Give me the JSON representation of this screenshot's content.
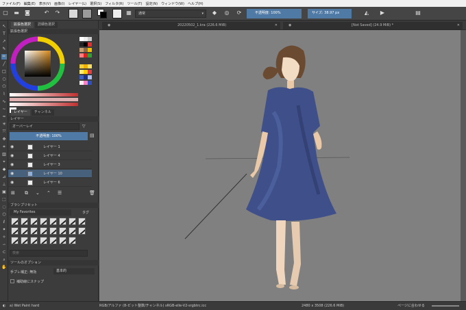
{
  "menu": [
    "ファイル(F)",
    "編集(E)",
    "表示(V)",
    "画像(I)",
    "レイヤー(L)",
    "選択(S)",
    "フィルタ(R)",
    "ツール(T)",
    "設定(N)",
    "ウィンドウ(W)",
    "ヘルプ(H)"
  ],
  "toolbar": {
    "blend_mode": "通常",
    "opacity_label": "不透明度:",
    "opacity_value": "100%",
    "size_label": "サイズ:",
    "size_value": "38.97 px"
  },
  "docker_tabs": [
    "拡張色選択",
    "詳細色選択"
  ],
  "color_panel_title": "拡張色選択",
  "layers": {
    "tabs": [
      "レイヤー",
      "チャンネル"
    ],
    "header": "レイヤー",
    "blend_mode": "オーバーレイ",
    "opacity": "不透明度:  100%",
    "items": [
      {
        "name": "レイヤー 1",
        "selected": false
      },
      {
        "name": "レイヤー 4",
        "selected": false
      },
      {
        "name": "レイヤー 3",
        "selected": false
      },
      {
        "name": "レイヤー 10",
        "selected": true
      },
      {
        "name": "レイヤー 6",
        "selected": false
      }
    ]
  },
  "brushes": {
    "header": "ブラシプリセット",
    "tag": "My Favorites",
    "tag_label": "タグ",
    "search_placeholder": "検索"
  },
  "tool_options": {
    "header": "ツールのオプション",
    "mode_label": "手ブレ補正: 無効",
    "mode_value": "基本的",
    "snap_label": "補助線にスナップ"
  },
  "documents": [
    {
      "title": "20220502_1.kra (226.6 MiB)"
    },
    {
      "title": "[Not Saved]  (24.9 MiB) *"
    }
  ],
  "status": {
    "brush": "a) Wet Paint hard",
    "color_profile": "RGB/アルファ (8-ビット整数/チャンネル)  sRGB-elle-V2-srgbtrc.icc",
    "dimensions": "2480 x 3508 (226.6 MiB)",
    "zoom_label": "ページに合わせる"
  },
  "colors": {
    "accent": "#4f7aa6",
    "dress": "#3f4f8a",
    "canvas_bg": "#808080"
  }
}
